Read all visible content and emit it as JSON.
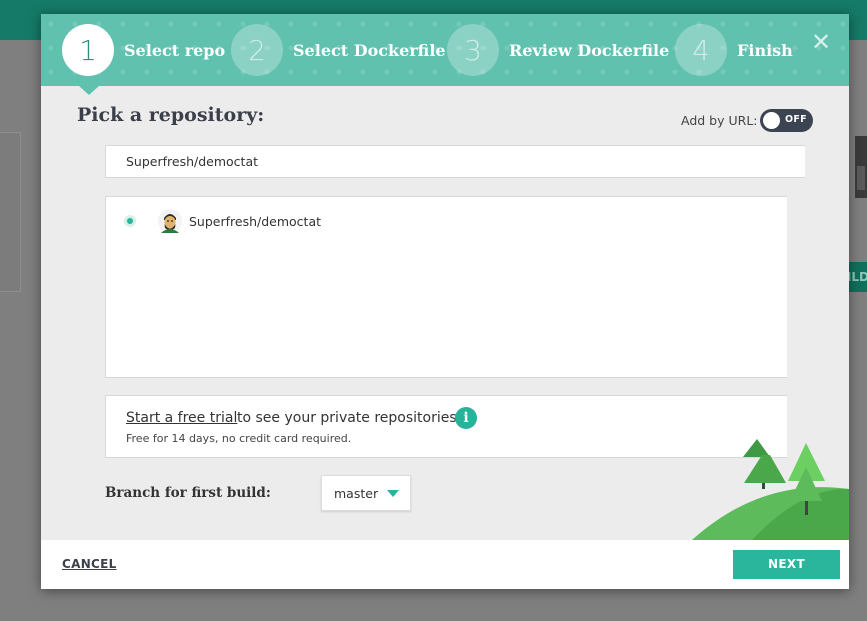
{
  "background": {
    "build_button_label": "BUILD"
  },
  "wizard": {
    "steps": [
      {
        "number": "1",
        "label": "Select repo"
      },
      {
        "number": "2",
        "label": "Select Dockerfile"
      },
      {
        "number": "3",
        "label": "Review Dockerfile"
      },
      {
        "number": "4",
        "label": "Finish"
      }
    ],
    "active_step": 1,
    "close_glyph": "✕"
  },
  "main": {
    "title": "Pick a repository:",
    "add_by_url_label": "Add by URL:",
    "toggle_text": "OFF",
    "search_value": "Superfresh/democtat",
    "repos": [
      {
        "name": "Superfresh/democtat",
        "selected": true
      }
    ],
    "trial": {
      "link_text": "Start a free trial",
      "rest_text": "to see your private repositories",
      "info_glyph": "i",
      "subtext": "Free for 14 days, no credit card required."
    },
    "branch_label": "Branch for first build:",
    "branch_value": "master"
  },
  "footer": {
    "cancel_label": "CANCEL",
    "next_label": "NEXT"
  },
  "colors": {
    "accent": "#2ab59d",
    "header": "#5fc1ae",
    "dark_toggle": "#3d4451"
  }
}
